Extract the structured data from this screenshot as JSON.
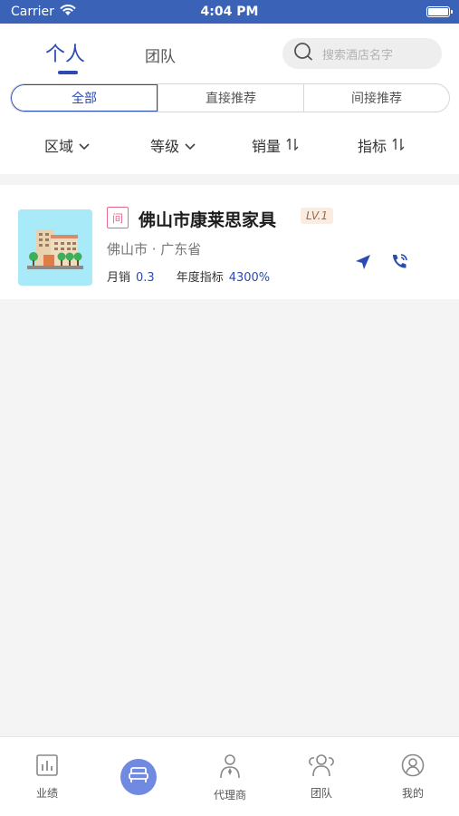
{
  "status_bar": {
    "carrier": "Carrier",
    "time": "4:04 PM"
  },
  "header": {
    "tabs": [
      {
        "label": "个人"
      },
      {
        "label": "团队"
      }
    ],
    "search": {
      "placeholder": "搜索酒店名字"
    },
    "segments": [
      {
        "label": "全部"
      },
      {
        "label": "直接推荐"
      },
      {
        "label": "间接推荐"
      }
    ],
    "filters": [
      {
        "label": "区域",
        "icon": "chevron-down-icon"
      },
      {
        "label": "等级",
        "icon": "chevron-down-icon"
      },
      {
        "label": "销量",
        "icon": "sort-icon"
      },
      {
        "label": "指标",
        "icon": "sort-icon"
      }
    ]
  },
  "card": {
    "tag": "间",
    "name": "佛山市康莱思家具",
    "level": "LV.1",
    "location": "佛山市 · 广东省",
    "monthly_sales_label": "月销",
    "monthly_sales_value": "0.3",
    "annual_target_label": "年度指标",
    "annual_target_value": "4300%"
  },
  "bottom_nav": [
    {
      "label": "业绩",
      "icon": "bar-chart-icon"
    },
    {
      "label": "",
      "icon": "bed-icon"
    },
    {
      "label": "代理商",
      "icon": "agent-icon"
    },
    {
      "label": "团队",
      "icon": "team-icon"
    },
    {
      "label": "我的",
      "icon": "profile-icon"
    }
  ],
  "colors": {
    "accent": "#2b4bb3",
    "status_bar": "#3a63b8",
    "tag": "#e86a8a"
  }
}
